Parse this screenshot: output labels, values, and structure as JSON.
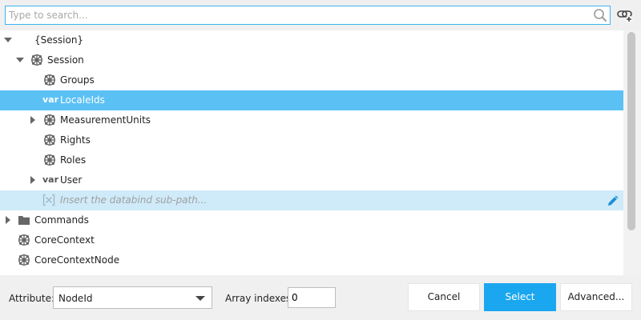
{
  "search": {
    "placeholder": "Type to search...",
    "value": ""
  },
  "tree": {
    "rows": [
      {
        "label": "{Session}"
      },
      {
        "label": "Session"
      },
      {
        "label": "Groups"
      },
      {
        "label": "LocaleIds",
        "type_label": "var"
      },
      {
        "label": "MeasurementUnits"
      },
      {
        "label": "Rights"
      },
      {
        "label": "Roles"
      },
      {
        "label": "User",
        "type_label": "var"
      },
      {
        "placeholder": "Insert the databind sub-path..."
      },
      {
        "label": "Commands"
      },
      {
        "label": "CoreContext"
      },
      {
        "label": "CoreContextNode"
      }
    ]
  },
  "footer": {
    "attribute_label": "Attribute:",
    "attribute_value": "NodeId",
    "array_label": "Array indexes:",
    "array_value": "0",
    "cancel_label": "Cancel",
    "select_label": "Select",
    "advanced_label": "Advanced..."
  },
  "colors": {
    "accent": "#1aa7f0",
    "selected_row": "#5bc1f5",
    "edit_row": "#cfeaf9",
    "search_border": "#3ab4ee"
  },
  "icons": {
    "search": "magnifier-icon",
    "link": "link-add-icon",
    "object": "object-node-icon",
    "folder": "folder-icon",
    "edit": "pencil-icon"
  }
}
